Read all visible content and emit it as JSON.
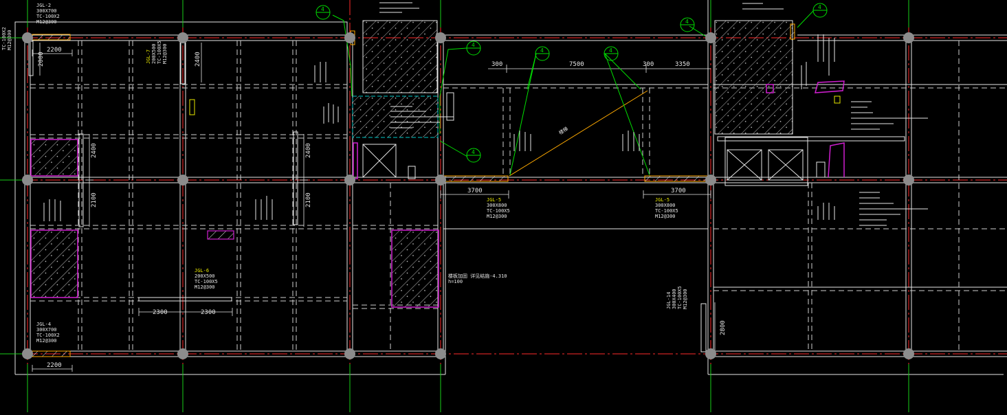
{
  "colors": {
    "background": "#000000",
    "axis_red": "#ff2a2a",
    "axis_green": "#19d019",
    "beam_white": "#e6e6e6",
    "dashed_beam": "#cfcfcf",
    "label_yellow": "#e8e800",
    "label_red": "#ff3030",
    "callout_green": "#00e000",
    "hatch_magenta": "#d01fd0",
    "hatch_cyan": "#00c8c8",
    "diagonal_orange": "#ffaa00",
    "column_grey": "#8c8c8c"
  },
  "dimensions": {
    "d_2200_top": "2200",
    "d_2400_top": "2400",
    "d_2400_left": "2400",
    "d_2100_left": "2100",
    "d_2400_mid": "2400",
    "d_2100_mid": "2100",
    "d_2300_a": "2300",
    "d_2300_b": "2300",
    "d_2200_bottom": "2200",
    "d_300": "300",
    "d_7500": "7500",
    "d_300_b": "300",
    "d_3350": "3350",
    "d_3700_a": "3700",
    "d_3700_b": "3700",
    "d_2800": "2800",
    "d_2000": "2000"
  },
  "labels": {
    "jgl2": [
      "JGL-2",
      "300X700",
      "TC-100X2",
      "M12@300"
    ],
    "jgl4": [
      "JGL-4",
      "300X700",
      "TC-100X2",
      "M12@300"
    ],
    "jgl5a": [
      "JGL-5",
      "300X800",
      "TC-100X5",
      "M12@300"
    ],
    "jgl5b": [
      "JGL-5",
      "300X800",
      "TC-100X5",
      "M12@300"
    ],
    "jgl6": [
      "JGL-6",
      "200X500",
      "TC-100X5",
      "M12@300"
    ],
    "jgl7": [
      "JGL-7",
      "200X500",
      "TC-100X5",
      "M12@300"
    ],
    "jgl14": [
      "JGL-14",
      "300X400",
      "TC-100X5",
      "M12@300"
    ],
    "left_edge": [
      "TC-100X2",
      "M12@300"
    ],
    "slab_note": [
      "楼板加固 详见结施-4.310",
      "h=100"
    ],
    "diagonal": "楼梯"
  },
  "callouts": {
    "c1": "4",
    "c2": "4",
    "c3": "4",
    "c4": "4",
    "c5": "4",
    "c6": "4",
    "c7": "4"
  }
}
